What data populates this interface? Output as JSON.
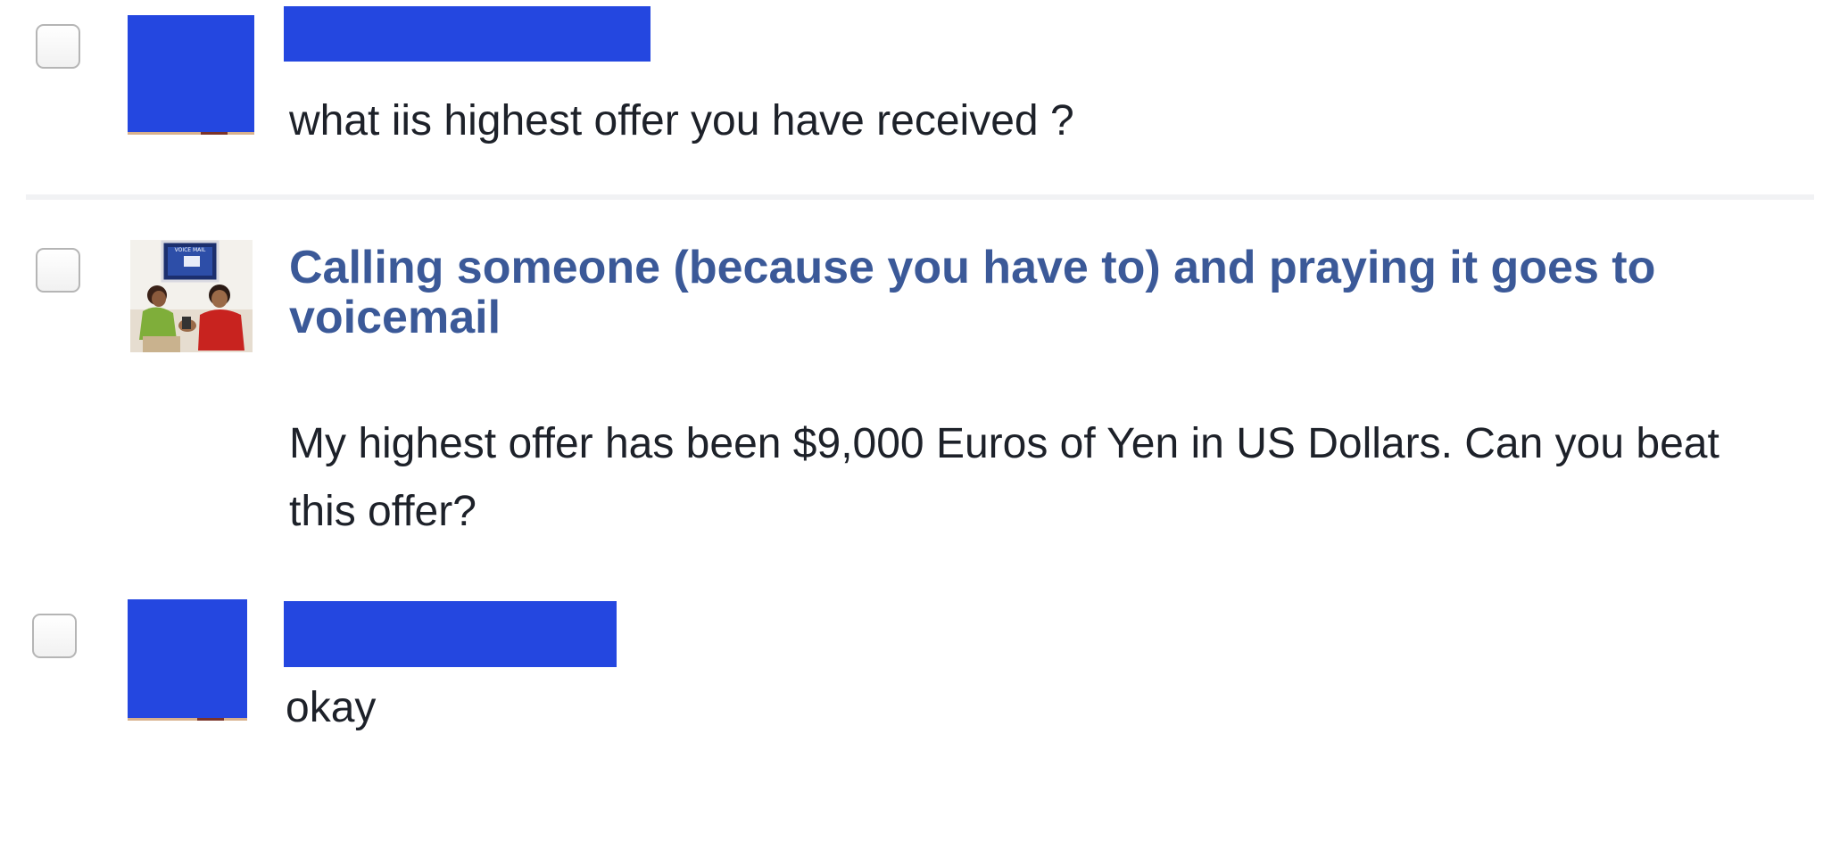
{
  "messages": [
    {
      "sender": "",
      "text": "what iis highest offer you have received ?"
    },
    {
      "sender": "Calling someone (because you have to) and praying it goes to voicemail",
      "text": "My highest offer has been $9,000 Euros of Yen in US Dollars. Can you beat this offer?",
      "avatar_sign": "VOICE MAIL"
    },
    {
      "sender": "",
      "text": "okay"
    }
  ],
  "colors": {
    "redaction": "#2447e0",
    "link": "#3b5998",
    "text": "#1d2129"
  }
}
